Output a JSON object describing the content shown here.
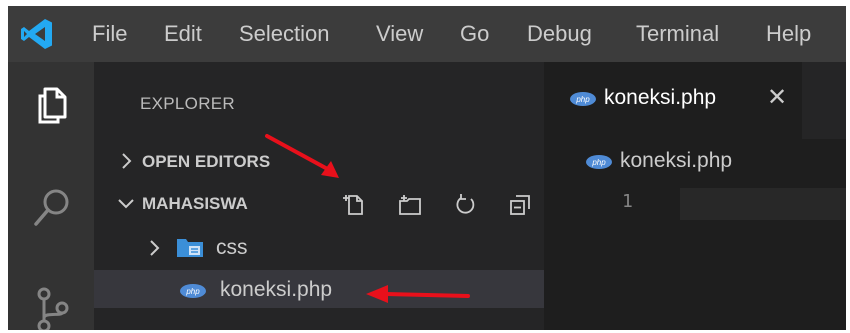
{
  "menu": {
    "items": [
      "File",
      "Edit",
      "Selection",
      "View",
      "Go",
      "Debug",
      "Terminal",
      "Help"
    ]
  },
  "activity_bar": {
    "icons": [
      "files-icon",
      "search-icon",
      "source-control-icon"
    ]
  },
  "sidebar": {
    "title": "EXPLORER",
    "open_editors_label": "OPEN EDITORS",
    "project_label": "MAHASISWA",
    "actions": [
      "new-file-icon",
      "new-folder-icon",
      "refresh-icon",
      "collapse-all-icon"
    ],
    "tree": [
      {
        "label": "css",
        "type": "folder",
        "expanded": false
      },
      {
        "label": "koneksi.php",
        "type": "file",
        "selected": true
      }
    ]
  },
  "editor": {
    "tab_label": "koneksi.php",
    "tab_close": "✕",
    "breadcrumb": "koneksi.php",
    "line_number": "1"
  },
  "colors": {
    "php_icon": "#4f8bd6",
    "folder_icon": "#3b8fd8",
    "vscode_logo": "#23a9f2",
    "annotation_arrow": "#e8101b"
  }
}
